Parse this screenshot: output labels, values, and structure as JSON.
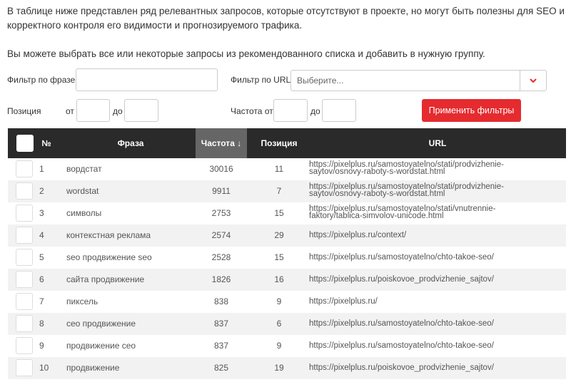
{
  "intro": {
    "p1": "В таблице ниже представлен ряд релевантных запросов, которые отсутствуют в проекте, но могут быть полезны для SEO и корректного контроля его видимости и прогнозируемого трафика.",
    "p2": "Вы можете выбрать все или некоторые запросы из рекомендованного списка и добавить в нужную группу."
  },
  "filters": {
    "phrase_label": "Фильтр по фразе",
    "phrase_value": "",
    "url_label": "Фильтр по URL",
    "url_placeholder": "Выберите...",
    "position_label": "Позиция",
    "from_label": "от",
    "to_label": "до",
    "frequency_label": "Частота от",
    "freq_to_label": "до",
    "apply_button": "Применить фильтры"
  },
  "table": {
    "headers": {
      "num": "№",
      "phrase": "Фраза",
      "frequency": "Частота ↓",
      "position": "Позиция",
      "url": "URL"
    },
    "rows": [
      {
        "num": "1",
        "phrase": "вордстат",
        "freq": "30016",
        "pos": "11",
        "url": "https://pixelplus.ru/samostoyatelno/stati/prodvizhenie-saytov/osnovy-raboty-s-wordstat.html"
      },
      {
        "num": "2",
        "phrase": "wordstat",
        "freq": "9911",
        "pos": "7",
        "url": "https://pixelplus.ru/samostoyatelno/stati/prodvizhenie-saytov/osnovy-raboty-s-wordstat.html"
      },
      {
        "num": "3",
        "phrase": "символы",
        "freq": "2753",
        "pos": "15",
        "url": "https://pixelplus.ru/samostoyatelno/stati/vnutrennie-faktory/tablica-simvolov-unicode.html"
      },
      {
        "num": "4",
        "phrase": "контекстная реклама",
        "freq": "2574",
        "pos": "29",
        "url": "https://pixelplus.ru/context/"
      },
      {
        "num": "5",
        "phrase": "seo продвижение seo",
        "freq": "2528",
        "pos": "15",
        "url": "https://pixelplus.ru/samostoyatelno/chto-takoe-seo/"
      },
      {
        "num": "6",
        "phrase": "сайта продвижение",
        "freq": "1826",
        "pos": "16",
        "url": "https://pixelplus.ru/poiskovoe_prodvizhenie_sajtov/"
      },
      {
        "num": "7",
        "phrase": "пиксель",
        "freq": "838",
        "pos": "9",
        "url": "https://pixelplus.ru/"
      },
      {
        "num": "8",
        "phrase": "сео продвижение",
        "freq": "837",
        "pos": "6",
        "url": "https://pixelplus.ru/samostoyatelno/chto-takoe-seo/"
      },
      {
        "num": "9",
        "phrase": "продвижение сео",
        "freq": "837",
        "pos": "9",
        "url": "https://pixelplus.ru/samostoyatelno/chto-takoe-seo/"
      },
      {
        "num": "10",
        "phrase": "продвижение",
        "freq": "825",
        "pos": "19",
        "url": "https://pixelplus.ru/poiskovoe_prodvizhenie_sajtov/"
      }
    ]
  },
  "colors": {
    "accent": "#e52b2f",
    "header_bg": "#2a2a2a",
    "active_header_bg": "#666666"
  }
}
